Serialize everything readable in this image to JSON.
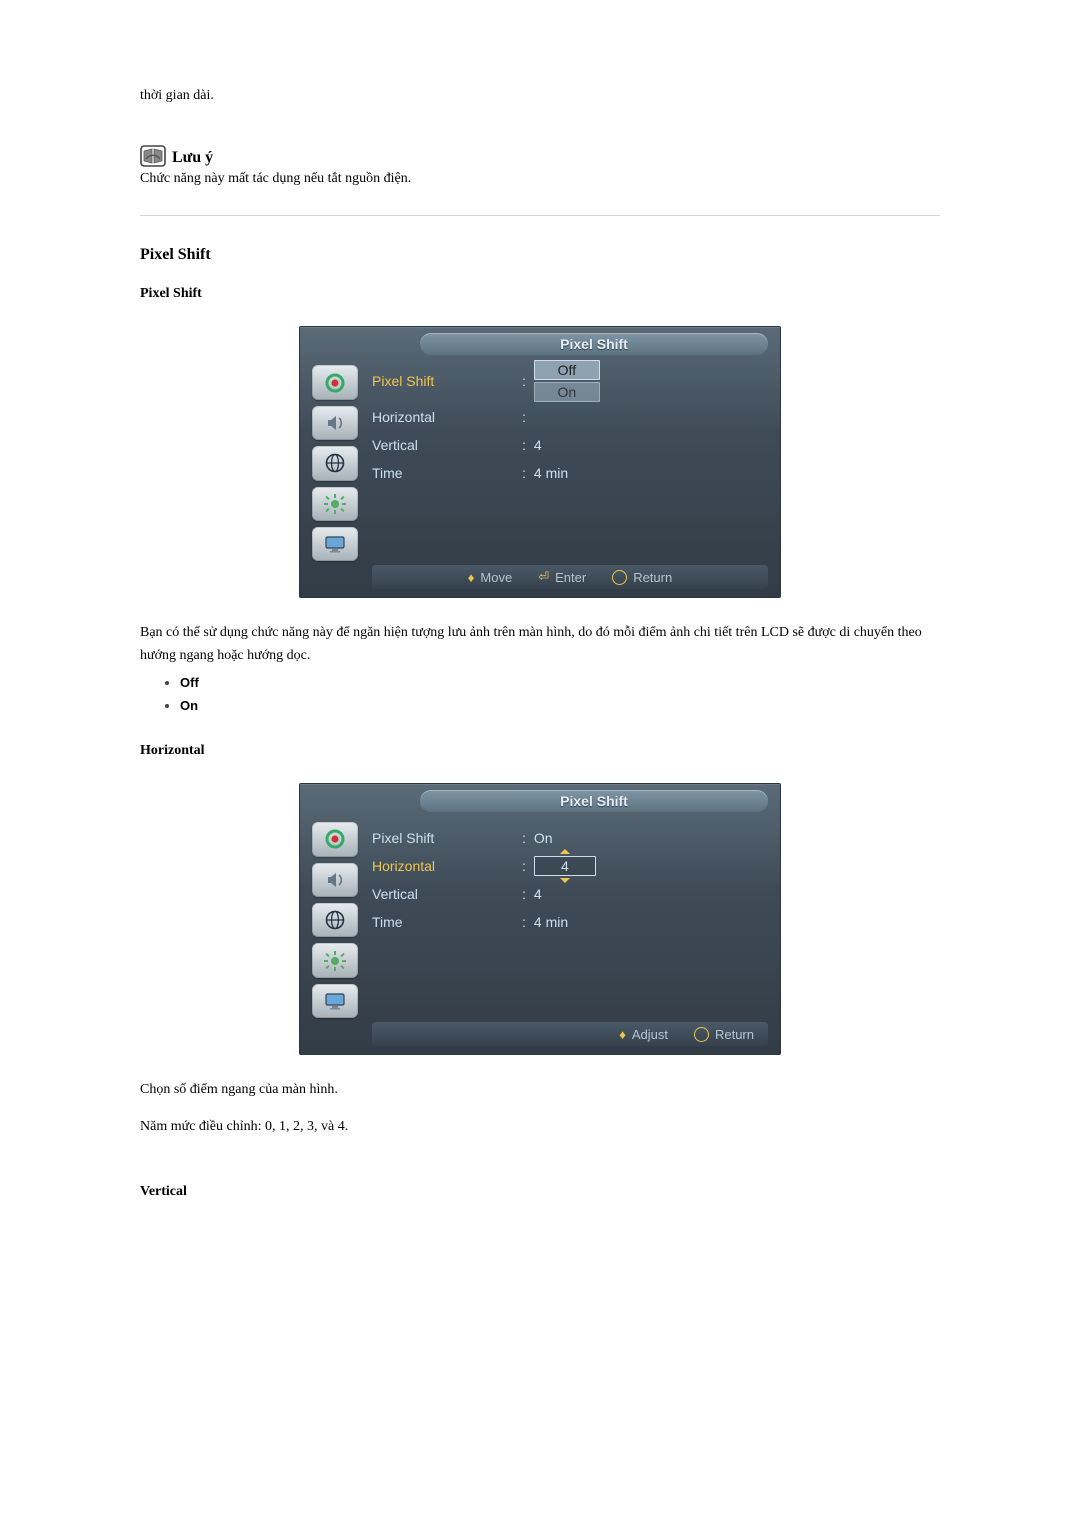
{
  "intro_line": "thời gian dài.",
  "note": {
    "title": "Lưu ý",
    "body": "Chức năng này mất tác dụng nếu tắt nguồn điện."
  },
  "section1": {
    "heading": "Pixel Shift",
    "subheading": "Pixel Shift",
    "menu_title": "Pixel Shift",
    "items": {
      "pixel_shift_label": "Pixel Shift",
      "horizontal_label": "Horizontal",
      "vertical_label": "Vertical",
      "time_label": "Time"
    },
    "values": {
      "pixel_shift_selected": "Off",
      "pixel_shift_other": "On",
      "vertical": "4",
      "time": "4 min"
    },
    "footer": {
      "move": "Move",
      "enter": "Enter",
      "return": "Return"
    },
    "desc": "Bạn có thể sử dụng chức năng này để ngăn hiện tượng lưu ảnh trên màn hình, do đó mỗi điểm ảnh chi tiết trên LCD sẽ được di chuyển theo hướng ngang hoặc hướng dọc.",
    "options": {
      "off": "Off",
      "on": "On"
    }
  },
  "section2": {
    "heading": "Horizontal",
    "menu_title": "Pixel Shift",
    "items": {
      "pixel_shift_label": "Pixel Shift",
      "horizontal_label": "Horizontal",
      "vertical_label": "Vertical",
      "time_label": "Time"
    },
    "values": {
      "pixel_shift": "On",
      "horizontal": "4",
      "vertical": "4",
      "time": "4 min"
    },
    "footer": {
      "adjust": "Adjust",
      "return": "Return"
    },
    "desc1": "Chọn số điểm ngang của màn hình.",
    "desc2": "Năm mức điều chỉnh: 0, 1, 2, 3, và 4."
  },
  "section3": {
    "heading": "Vertical"
  },
  "icons": {
    "picture": "picture-icon",
    "sound": "sound-icon",
    "channel": "network-icon",
    "setup": "gear-icon",
    "multi": "monitor-icon"
  }
}
